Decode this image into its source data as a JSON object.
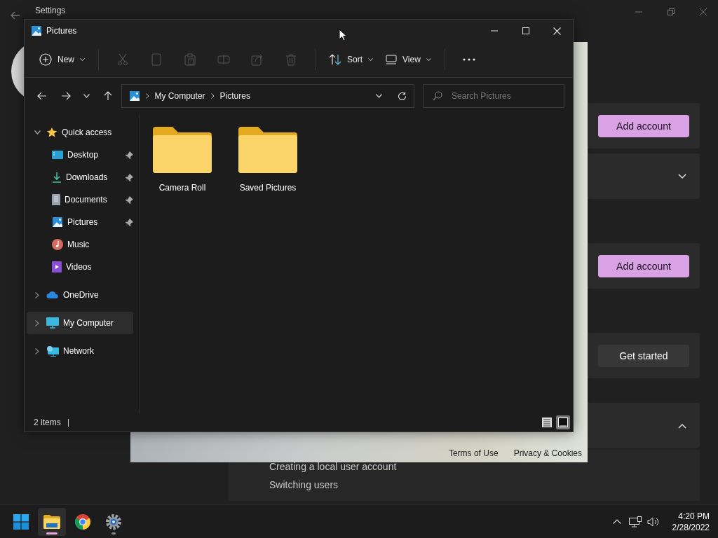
{
  "settings_window": {
    "title": "Settings",
    "cards": [
      {
        "kind": "button",
        "button": "Add account",
        "accent": true
      },
      {
        "kind": "expander",
        "expanded": false
      },
      {
        "kind": "button",
        "button": "Add account",
        "accent": true
      },
      {
        "kind": "button",
        "button": "Get started",
        "accent": false
      },
      {
        "kind": "expander",
        "expanded": true,
        "links": [
          "Creating a local user account",
          "Switching users"
        ]
      }
    ]
  },
  "web_panel": {
    "links": [
      "Terms of Use",
      "Privacy & Cookies"
    ]
  },
  "explorer": {
    "title": "Pictures",
    "toolbar": [
      {
        "kind": "new",
        "label": "New",
        "disabled": false
      },
      {
        "kind": "cut",
        "disabled": true
      },
      {
        "kind": "copy",
        "disabled": true
      },
      {
        "kind": "paste",
        "disabled": true
      },
      {
        "kind": "rename",
        "disabled": true
      },
      {
        "kind": "share",
        "disabled": true
      },
      {
        "kind": "delete",
        "disabled": true
      },
      {
        "kind": "sort",
        "label": "Sort",
        "disabled": false
      },
      {
        "kind": "view",
        "label": "View",
        "disabled": false
      },
      {
        "kind": "more",
        "disabled": false
      }
    ],
    "breadcrumb": [
      "My Computer",
      "Pictures"
    ],
    "search": {
      "placeholder": "Search Pictures"
    },
    "nav": [
      {
        "label": "Quick access",
        "kind": "star",
        "expanded": true,
        "selected": false,
        "children": [
          {
            "label": "Desktop",
            "kind": "desktop",
            "pinned": true,
            "selected": false
          },
          {
            "label": "Downloads",
            "kind": "download",
            "pinned": true,
            "selected": false
          },
          {
            "label": "Documents",
            "kind": "document",
            "pinned": true,
            "selected": false
          },
          {
            "label": "Pictures",
            "kind": "picture",
            "pinned": true,
            "selected": false
          },
          {
            "label": "Music",
            "kind": "music",
            "pinned": false,
            "selected": false
          },
          {
            "label": "Videos",
            "kind": "video",
            "pinned": false,
            "selected": false
          }
        ]
      },
      {
        "label": "OneDrive",
        "kind": "cloud",
        "expanded": false,
        "selected": false
      },
      {
        "label": "My Computer",
        "kind": "computer",
        "expanded": false,
        "selected": true
      },
      {
        "label": "Network",
        "kind": "network",
        "expanded": false,
        "selected": false
      }
    ],
    "items": [
      {
        "name": "Camera Roll"
      },
      {
        "name": "Saved Pictures"
      }
    ],
    "status": "2 items",
    "view_buttons": [
      {
        "kind": "details",
        "selected": false
      },
      {
        "kind": "large-icons",
        "selected": true
      }
    ]
  },
  "taskbar": {
    "apps": [
      {
        "kind": "start",
        "active": false,
        "running": false
      },
      {
        "kind": "explorer",
        "active": true,
        "running": true
      },
      {
        "kind": "chrome",
        "active": false,
        "running": false
      },
      {
        "kind": "settings",
        "active": false,
        "running": true
      }
    ],
    "time": "4:20 PM",
    "date": "2/28/2022"
  }
}
